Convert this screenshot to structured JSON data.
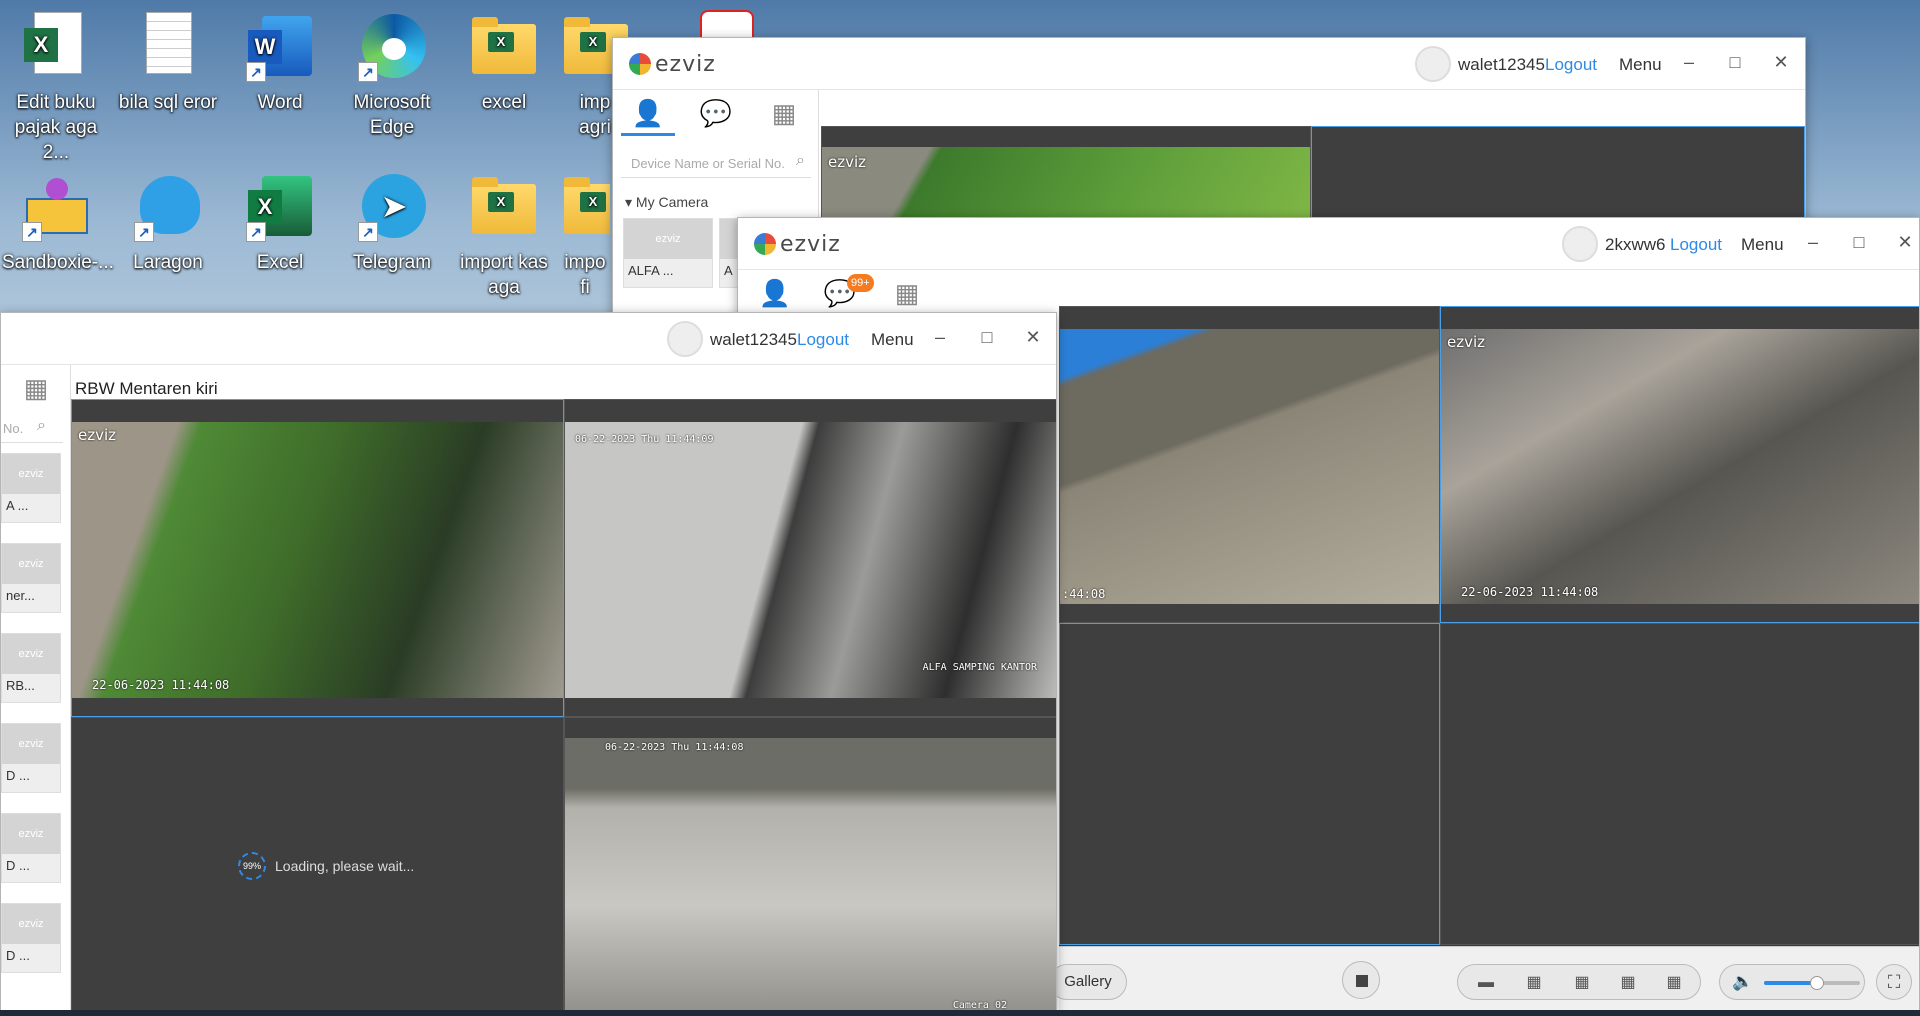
{
  "desktop": {
    "icons": [
      {
        "label": "Edit buku\npajak aga 2...",
        "icon": "excel-file-icon"
      },
      {
        "label": "bila sql eror",
        "icon": "text-file-icon"
      },
      {
        "label": "Word",
        "icon": "word-icon"
      },
      {
        "label": "Microsoft\nEdge",
        "icon": "edge-icon"
      },
      {
        "label": "excel",
        "icon": "folder-icon"
      },
      {
        "label": "imp\nagri",
        "icon": "folder-icon"
      },
      {
        "label": "Sandboxie-...",
        "icon": "sandboxie-icon"
      },
      {
        "label": "Laragon",
        "icon": "laragon-icon"
      },
      {
        "label": "Excel",
        "icon": "excel-icon"
      },
      {
        "label": "Telegram",
        "icon": "telegram-icon"
      },
      {
        "label": "import kas\naga",
        "icon": "folder-icon"
      },
      {
        "label": "impo\nfi",
        "icon": "folder-icon"
      }
    ]
  },
  "window_back": {
    "logo": "ezviz",
    "username": "walet12345",
    "logout": "Logout",
    "menu": "Menu",
    "search_placeholder": "Device Name or Serial No.",
    "section": "My Camera",
    "devices": [
      "ALFA ...",
      "A"
    ]
  },
  "window_right": {
    "logo": "ezviz",
    "username": "2kxww6",
    "logout": "Logout",
    "menu": "Menu",
    "badge": "99+",
    "stamp_left": ":44:08",
    "stamp_right": "22-06-2023 11:44:08",
    "gallery": "Gallery"
  },
  "window_front": {
    "username": "walet12345",
    "logout": "Logout",
    "menu": "Menu",
    "title": "RBW Mentaren kiri",
    "search_placeholder": "No.",
    "devices": [
      "A ...",
      "ner...",
      "RB...",
      "D ...",
      "D ...",
      "D ..."
    ],
    "cam1_stamp": "22-06-2023 11:44:08",
    "cam2_stamp": "06-22-2023 Thu 11:44:09",
    "cam2_label": "ALFA SAMPING KANTOR",
    "cam3_loading": "Loading, please wait...",
    "cam3_percent": "99%",
    "cam4_stamp": "06-22-2023 Thu 11:44:08",
    "cam4_label": "Camera 02"
  },
  "colors": {
    "accent": "#2d8ae6",
    "badge": "#f47b20",
    "feed_bg": "#3f3f3f"
  }
}
